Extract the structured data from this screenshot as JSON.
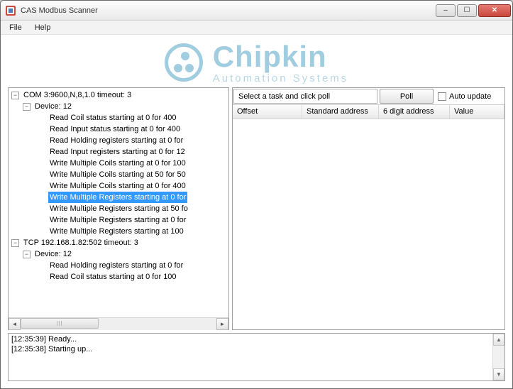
{
  "window": {
    "title": "CAS Modbus Scanner"
  },
  "menu": {
    "file": "File",
    "help": "Help"
  },
  "logo": {
    "brand": "Chipkin",
    "tagline": "Automation Systems"
  },
  "tree": {
    "root1": "COM 3:9600,N,8,1.0 timeout: 3",
    "root1_dev": "Device: 12",
    "r1_items": [
      "Read Coil status starting at 0 for 400",
      "Read Input status starting at 0 for 400",
      "Read Holding registers starting at 0 for",
      "Read Input registers starting at 0 for 12",
      "Write Multiple Coils starting at 0 for 100",
      "Write Multiple Coils starting at 50 for 50",
      "Write Multiple Coils starting at 0 for 400",
      "Write Multiple Registers starting at 0 for",
      "Write Multiple Registers starting at 50 fo",
      "Write Multiple Registers starting at 0 for",
      "Write Multiple Registers starting at 100"
    ],
    "root2": "TCP 192.168.1.82:502 timeout: 3",
    "root2_dev": "Device: 12",
    "r2_items": [
      "Read Holding registers starting at 0 for",
      "Read Coil status starting at 0 for 100"
    ],
    "selected_index": 7
  },
  "rightpanel": {
    "hint": "Select a task and click poll",
    "poll_label": "Poll",
    "auto_label": "Auto update",
    "columns": {
      "c1": "Offset",
      "c2": "Standard address",
      "c3": "6 digit address",
      "c4": "Value"
    }
  },
  "log": {
    "lines": [
      "[12:35:39] Ready...",
      "[12:35:38] Starting up..."
    ]
  }
}
